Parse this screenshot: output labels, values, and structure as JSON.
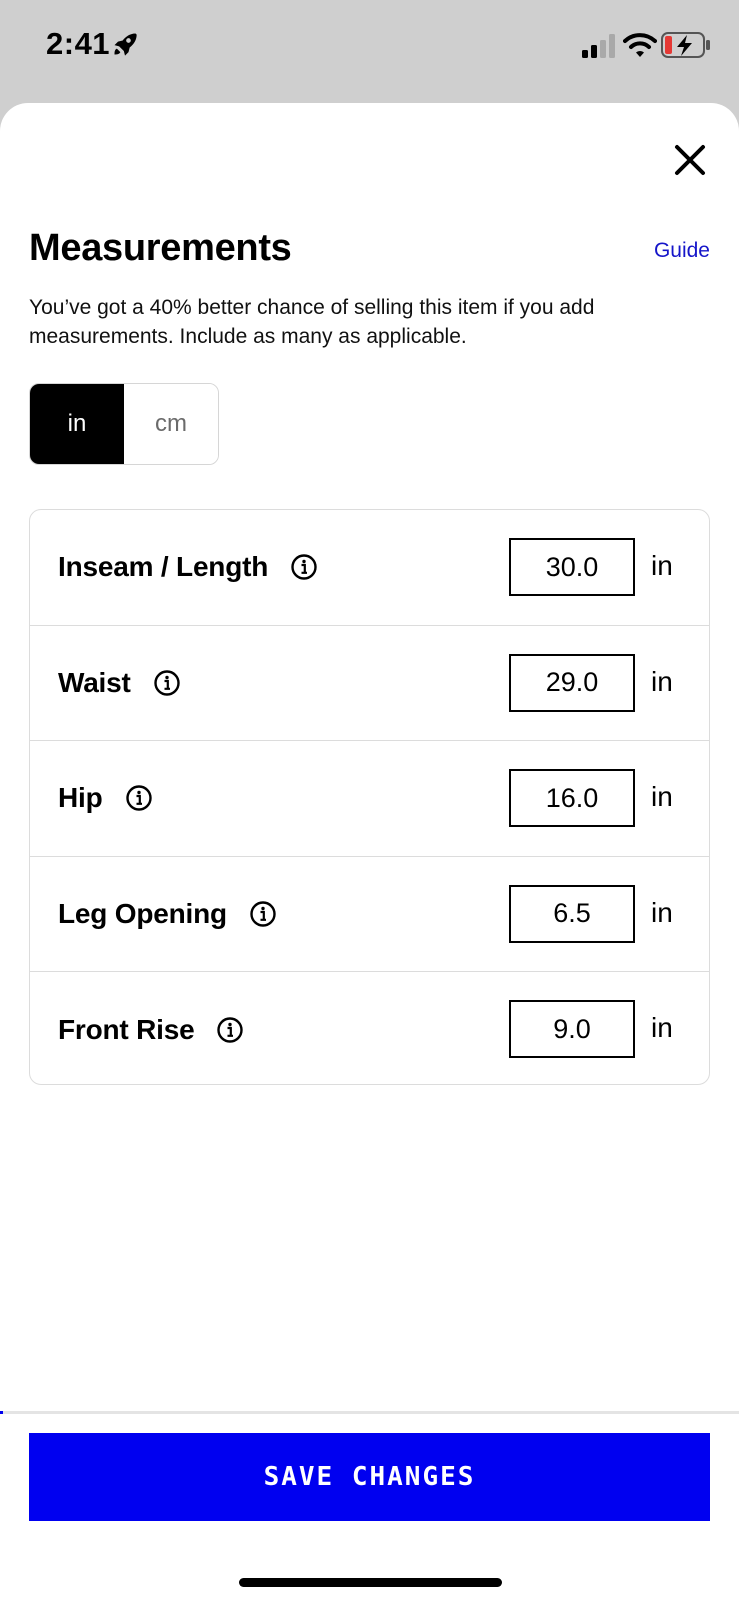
{
  "status_bar": {
    "time": "2:41",
    "icons": [
      "rocket-icon",
      "cellular-signal-icon",
      "wifi-icon",
      "battery-charging-icon"
    ]
  },
  "modal": {
    "close_icon": "close-icon",
    "title": "Measurements",
    "guide_label": "Guide",
    "subtitle": "You’ve got a 40% better chance of selling this item if you add measurements. Include as many as applicable.",
    "units": {
      "options": [
        "in",
        "cm"
      ],
      "selected": "in"
    },
    "measurements": [
      {
        "label": "Inseam / Length",
        "value": "30.0",
        "unit": "in",
        "icon": "info-icon"
      },
      {
        "label": "Waist",
        "value": "29.0",
        "unit": "in",
        "icon": "info-icon"
      },
      {
        "label": "Hip",
        "value": "16.0",
        "unit": "in",
        "icon": "info-icon"
      },
      {
        "label": "Leg Opening",
        "value": "6.5",
        "unit": "in",
        "icon": "info-icon"
      },
      {
        "label": "Front Rise",
        "value": "9.0",
        "unit": "in",
        "icon": "info-icon"
      }
    ],
    "save_label": "SAVE CHANGES"
  },
  "colors": {
    "accent": "#0000f0",
    "link": "#1515c9",
    "battery_low": "#e53935",
    "backdrop": "#cfcfcf"
  }
}
